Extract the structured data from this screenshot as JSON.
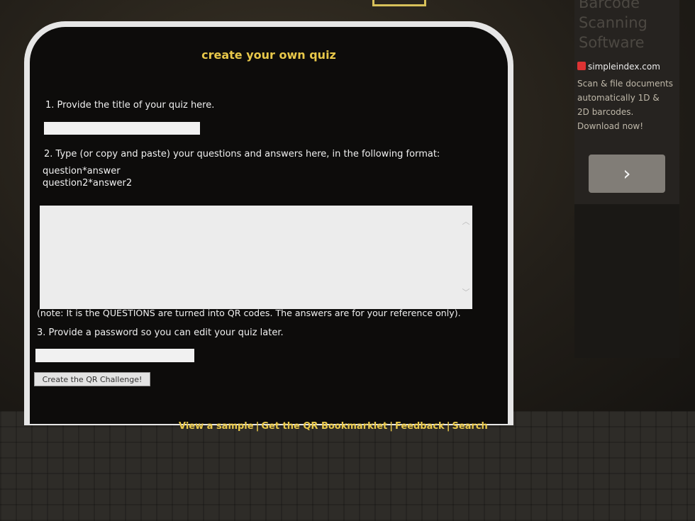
{
  "quiz_form": {
    "heading": "create your own quiz",
    "step1_label": "1. Provide the title of your quiz here.",
    "step1_value": "",
    "step2_label": "2. Type (or copy and paste) your questions and answers here, in the following format:",
    "format_line1": "question*answer",
    "format_line2": "question2*answer2",
    "questions_value": "",
    "note": "(note: It is the QUESTIONS are turned into QR codes. The answers are for your reference only).",
    "step3_label": "3. Provide a password so you can edit your quiz later.",
    "password_value": "",
    "submit_label": "Create the QR Challenge!"
  },
  "footer_links": {
    "view_sample": "View a sample",
    "bookmarklet": "Get the QR Bookmarklet",
    "feedback": "Feedback",
    "search": "Search",
    "separator": "|"
  },
  "ad": {
    "header_line1": "Barcode",
    "header_line2": "Scanning",
    "header_line3": "Software",
    "site": "simpleindex.com",
    "description": "Scan & file documents automatically 1D & 2D barcodes. Download now!",
    "next_glyph": "›",
    "icon": "simpleindex-logo-icon"
  },
  "colors": {
    "accent": "#e8c84a",
    "panel": "#0d0c0b",
    "frame": "#e6e6e6"
  }
}
